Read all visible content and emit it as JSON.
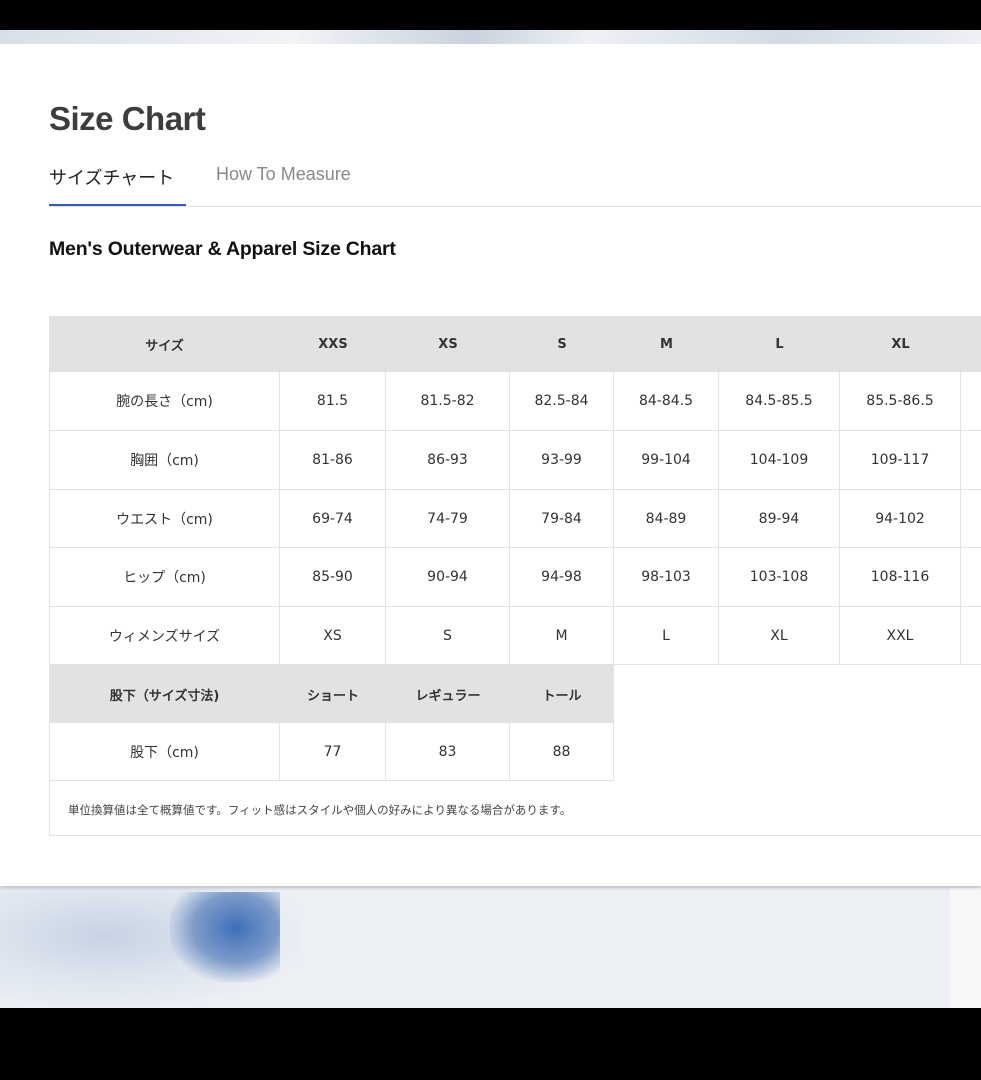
{
  "header": {
    "title": "Size Chart",
    "tabs": [
      {
        "label": "サイズチャート",
        "active": true
      },
      {
        "label": "How To Measure",
        "active": false
      }
    ],
    "accent_color": "#3658c4"
  },
  "size_chart": {
    "subtitle": "Men's Outerwear & Apparel Size Chart",
    "main_table": {
      "headers": [
        "サイズ",
        "XXS",
        "XS",
        "S",
        "M",
        "L",
        "XL"
      ],
      "rows": [
        {
          "label": "腕の長さ（cm)",
          "values": [
            "81.5",
            "81.5-82",
            "82.5-84",
            "84-84.5",
            "84.5-85.5",
            "85.5-86.5"
          ]
        },
        {
          "label": "胸囲（cm)",
          "values": [
            "81-86",
            "86-93",
            "93-99",
            "99-104",
            "104-109",
            "109-117"
          ]
        },
        {
          "label": "ウエスト（cm)",
          "values": [
            "69-74",
            "74-79",
            "79-84",
            "84-89",
            "89-94",
            "94-102"
          ]
        },
        {
          "label": "ヒップ（cm)",
          "values": [
            "85-90",
            "90-94",
            "94-98",
            "98-103",
            "103-108",
            "108-116"
          ]
        },
        {
          "label": "ウィメンズサイズ",
          "values": [
            "XS",
            "S",
            "M",
            "L",
            "XL",
            "XXL"
          ]
        }
      ]
    },
    "inseam_table": {
      "headers": [
        "股下（サイズ寸法)",
        "ショート",
        "レギュラー",
        "トール"
      ],
      "rows": [
        {
          "label": "股下（cm)",
          "values": [
            "77",
            "83",
            "88"
          ]
        }
      ]
    },
    "note": "単位換算値は全て概算値です。フィット感はスタイルや個人の好みにより異なる場合があります。"
  }
}
